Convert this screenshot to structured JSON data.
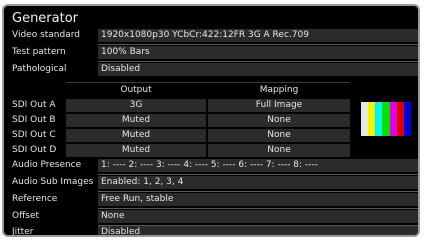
{
  "title": "Generator",
  "rows_top": [
    {
      "label": "Video standard",
      "value": "1920x1080p30 YCbCr:422:12FR 3G A Rec.709"
    },
    {
      "label": "Test pattern",
      "value": "100% Bars"
    },
    {
      "label": "Pathological",
      "value": "Disabled"
    }
  ],
  "sdi": {
    "headers": {
      "output": "Output",
      "mapping": "Mapping"
    },
    "rows": [
      {
        "label": "SDI Out A",
        "output": "3G",
        "mapping": "Full Image"
      },
      {
        "label": "SDI Out B",
        "output": "Muted",
        "mapping": "None"
      },
      {
        "label": "SDI Out C",
        "output": "Muted",
        "mapping": "None"
      },
      {
        "label": "SDI Out D",
        "output": "Muted",
        "mapping": "None"
      }
    ]
  },
  "rows_bottom": [
    {
      "label": "Audio Presence",
      "value": "1: ---- 2: ---- 3: ---- 4: ---- 5: ---- 6: ---- 7: ---- 8: ----"
    },
    {
      "label": "Audio Sub Images",
      "value": "Enabled: 1, 2, 3, 4"
    },
    {
      "label": "Reference",
      "value": "Free Run, stable"
    },
    {
      "label": "Offset",
      "value": "None"
    },
    {
      "label": "Jitter",
      "value": "Disabled"
    }
  ],
  "colorbars": [
    "#e6e6e6",
    "#f4f400",
    "#00f4f4",
    "#00e000",
    "#e000e0",
    "#e00000",
    "#0000e0"
  ]
}
